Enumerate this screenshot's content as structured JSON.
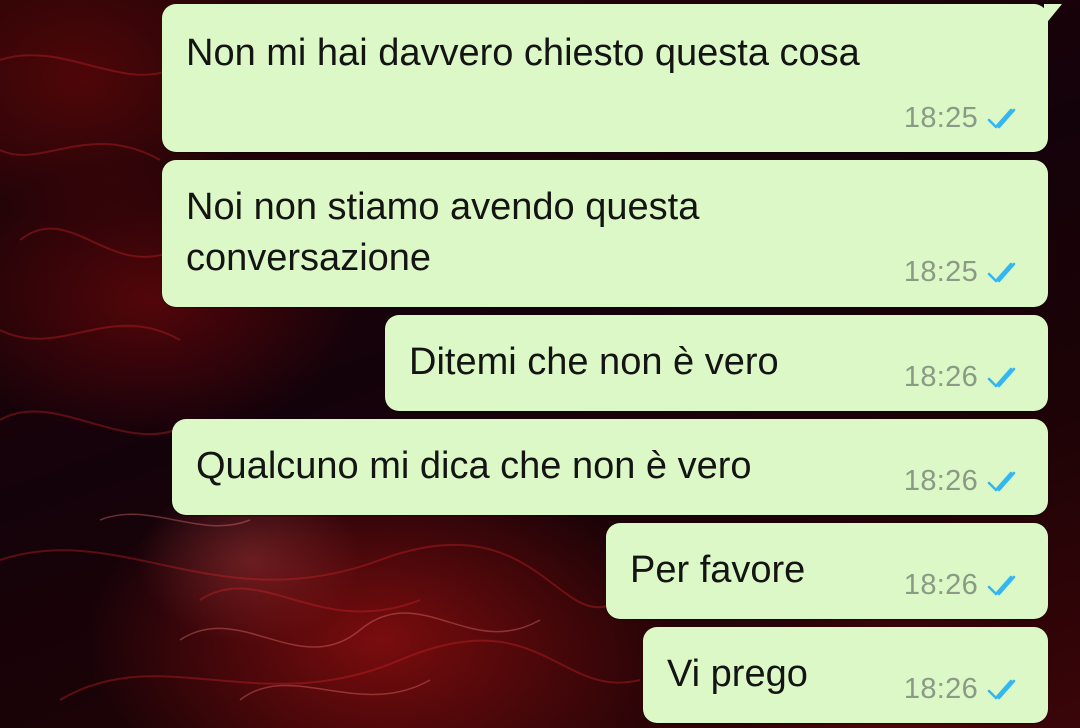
{
  "messages": [
    {
      "text": "Non mi hai davvero chiesto questa cosa",
      "time": "18:25",
      "status_icon": "double-check-read-icon"
    },
    {
      "text_lines": [
        "Noi non stiamo avendo questa",
        "conversazione"
      ],
      "time": "18:25",
      "status_icon": "double-check-read-icon"
    },
    {
      "text": "Ditemi che non è vero",
      "time": "18:26",
      "status_icon": "double-check-read-icon"
    },
    {
      "text": "Qualcuno mi dica che non è vero",
      "time": "18:26",
      "status_icon": "double-check-read-icon"
    },
    {
      "text": "Per favore",
      "time": "18:26",
      "status_icon": "double-check-read-icon"
    },
    {
      "text": "Vi prego",
      "time": "18:26",
      "status_icon": "double-check-read-icon"
    }
  ],
  "colors": {
    "bubble_outgoing": "#dcf8c6",
    "read_ticks": "#34b7f1",
    "time_text": "#8a9a86",
    "wallpaper_base": "#1a0306",
    "wallpaper_accent": "#c81414"
  }
}
